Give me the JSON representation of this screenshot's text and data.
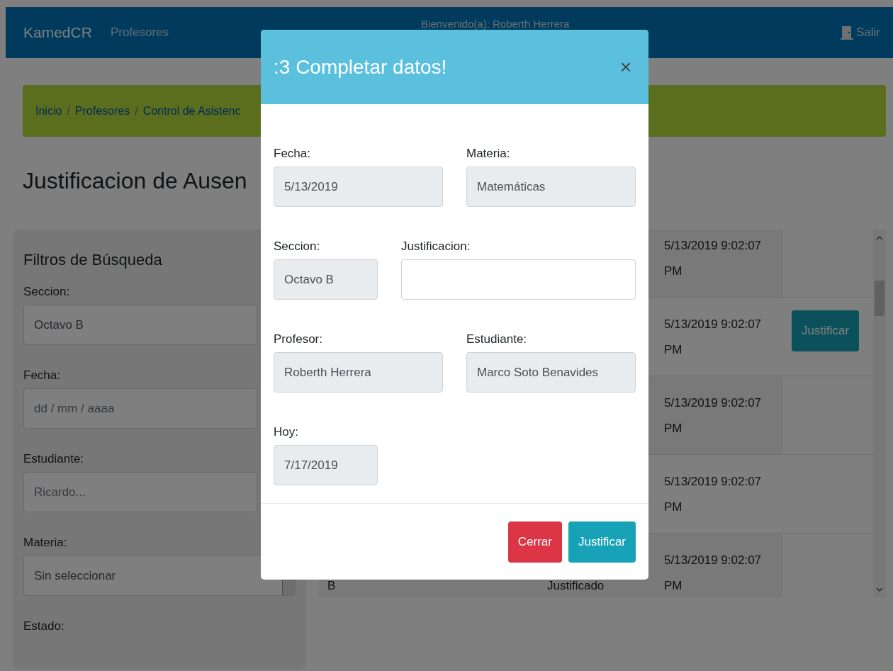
{
  "navbar": {
    "brand": "KamedCR",
    "links": [
      "Profesores"
    ],
    "welcome": "Bienvenido(a): Roberth Herrera",
    "logout": "Salir"
  },
  "breadcrumb": {
    "separator": "/",
    "items": [
      "Inicio",
      "Profesores",
      "Control de Asistenc"
    ]
  },
  "page_title": "Justificacion de Ausen",
  "filters": {
    "title": "Filtros de Búsqueda",
    "fields": [
      {
        "label": "Seccion:",
        "kind": "input",
        "value": "Octavo B"
      },
      {
        "label": "Fecha:",
        "kind": "date",
        "placeholder": "dd / mm / aaaa"
      },
      {
        "label": "Estudiante:",
        "kind": "input",
        "placeholder": "Ricardo..."
      },
      {
        "label": "Materia:",
        "kind": "select",
        "value": "Sin seleccionar"
      },
      {
        "label": "Estado:",
        "kind": "label"
      }
    ]
  },
  "table": {
    "rows": [
      {
        "date": "5/13/2019 9:02:07 PM"
      },
      {
        "date": "5/13/2019 9:02:07 PM",
        "button": "Justificar"
      },
      {
        "date": "5/13/2019 9:02:07 PM"
      },
      {
        "date": "5/13/2019 9:02:07 PM"
      },
      {
        "column_1": "B",
        "column_2": "Justificado",
        "date": "5/13/2019 9:02:07 PM"
      }
    ]
  },
  "modal": {
    "title": ":3 Completar datos!",
    "close": "×",
    "rows": [
      [
        {
          "label": "Fecha:",
          "value": "5/13/2019",
          "kind": "readonly"
        },
        {
          "label": "Materia:",
          "value": "Matemáticas",
          "kind": "readonly"
        }
      ],
      [
        {
          "label": "Seccion:",
          "value": "Octavo B",
          "kind": "readonly"
        },
        {
          "label": "Justificacion:",
          "kind": "input"
        }
      ],
      [
        {
          "label": "Profesor:",
          "value": "Roberth Herrera",
          "kind": "readonly"
        },
        {
          "label": "Estudiante:",
          "value": "Marco Soto Benavides",
          "kind": "readonly"
        }
      ],
      [
        {
          "label": "Hoy:",
          "value": "7/17/2019",
          "kind": "readonly"
        }
      ]
    ],
    "buttons": [
      {
        "label": "Cerrar",
        "kind": "danger"
      },
      {
        "label": "Justificar",
        "kind": "info"
      }
    ]
  }
}
